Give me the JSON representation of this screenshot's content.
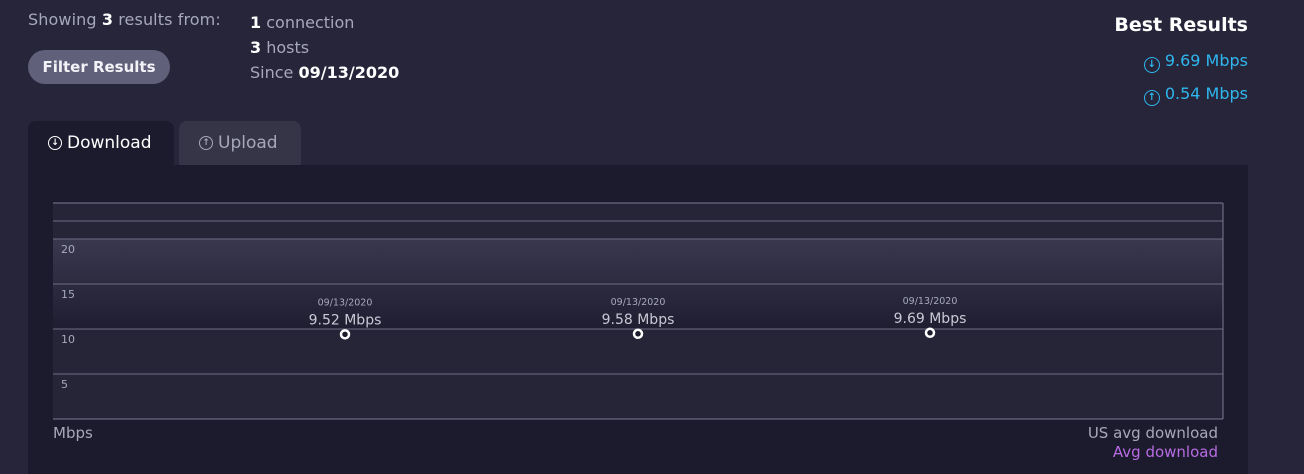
{
  "summary": {
    "showing_prefix": "Showing",
    "count": "3",
    "showing_suffix": "results from:",
    "connections_count": "1",
    "connections_label": "connection",
    "hosts_count": "3",
    "hosts_label": "hosts",
    "since_label": "Since",
    "since_date": "09/13/2020"
  },
  "filter_button": "Filter Results",
  "best_results": {
    "title": "Best Results",
    "download": "9.69 Mbps",
    "upload": "0.54 Mbps"
  },
  "tabs": [
    {
      "label": "Download",
      "icon": "arrow-down-circle-icon",
      "active": true
    },
    {
      "label": "Upload",
      "icon": "arrow-up-circle-icon",
      "active": false
    }
  ],
  "chart": {
    "unit_label": "Mbps",
    "us_avg_label": "US avg download",
    "avg_label": "Avg download"
  },
  "colors": {
    "accent_blue": "#2fb7ee",
    "avg_purple": "#b86be3",
    "background": "#26253a",
    "panel": "#1c1b2d"
  },
  "chart_data": {
    "type": "scatter",
    "x": [
      "09/13/2020",
      "09/13/2020",
      "09/13/2020"
    ],
    "values": [
      9.52,
      9.58,
      9.69
    ],
    "point_labels": [
      "9.52 Mbps",
      "9.58 Mbps",
      "9.69 Mbps"
    ],
    "yticks": [
      5,
      10,
      15,
      20
    ],
    "ylim": [
      0,
      24
    ],
    "ylabel": "Mbps",
    "us_avg_band": [
      10,
      20
    ],
    "legend": [
      "US avg download",
      "Avg download"
    ],
    "grid": true
  }
}
